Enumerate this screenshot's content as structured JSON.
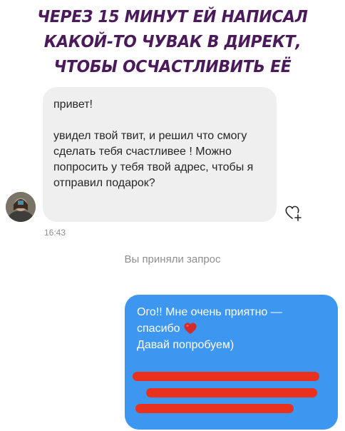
{
  "caption": {
    "lines": [
      "ЧЕРЕЗ 15 МИНУТ ЕЙ НАПИСАЛ",
      "КАКОЙ-ТО ЧУВАК В ДИРЕКТ,",
      "ЧТОБЫ ОСЧАСТЛИВИТЬ ЕЁ"
    ]
  },
  "incoming_message": {
    "greeting": "привет!",
    "body": "увидел твой твит, и решил что смогу сделать тебя счастливее ! Можно попросить у тебя твой адрес, чтобы я отправил подарок?",
    "timestamp": "16:43"
  },
  "system_notice": "Вы приняли запрос",
  "outgoing_message": {
    "line1": "Ого!! Мне очень приятно —",
    "line2": "спасибо",
    "line3": "Давай попробуем)"
  },
  "colors": {
    "caption": "#4a1a5a",
    "incoming_bubble": "#efefef",
    "outgoing_bubble": "#3d97f0",
    "redaction": "#e8321e",
    "heart": "#d42a2a"
  },
  "icons": {
    "react": "heart-plus-icon",
    "emoji": "red-heart-emoji"
  }
}
